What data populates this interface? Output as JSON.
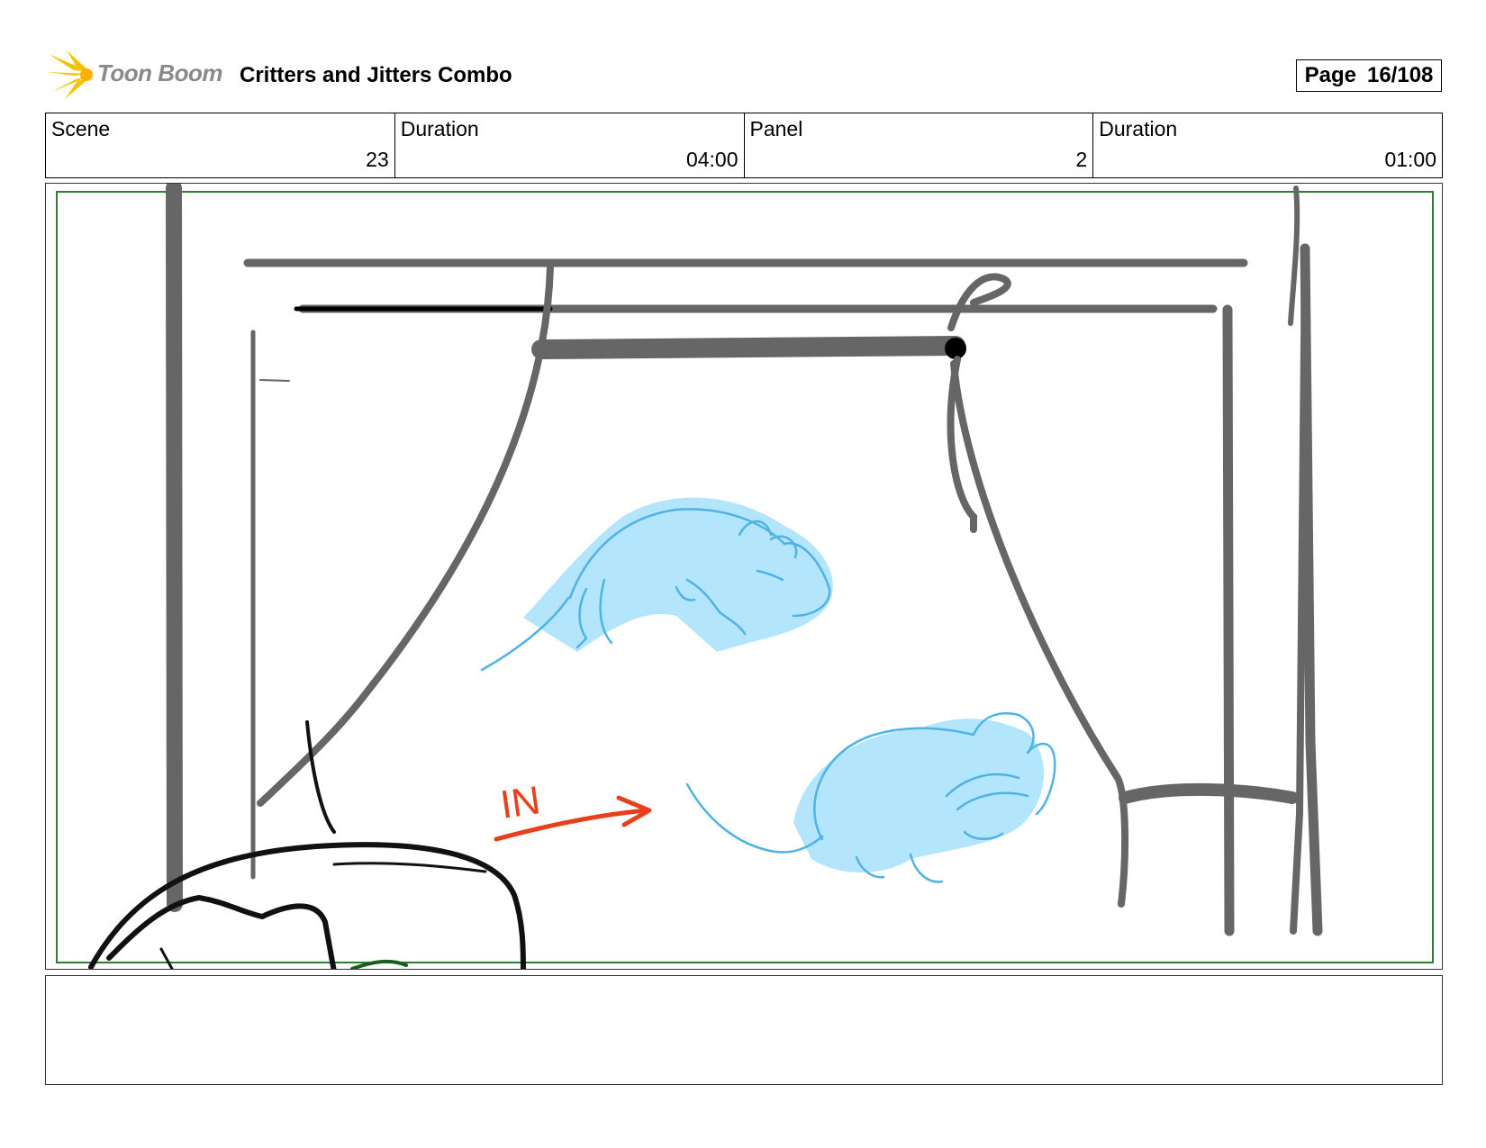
{
  "header": {
    "logo_text": "Toon Boom",
    "project_title": "Critters and Jitters Combo",
    "page_label": "Page",
    "page_value": "16/108"
  },
  "info": {
    "scene_label": "Scene",
    "scene_value": "23",
    "scene_duration_label": "Duration",
    "scene_duration_value": "04:00",
    "panel_label": "Panel",
    "panel_value": "2",
    "panel_duration_label": "Duration",
    "panel_duration_value": "01:00"
  },
  "panel": {
    "annotation_text": "IN",
    "colors": {
      "safe_frame": "#2e7d32",
      "set_lines": "#666666",
      "mouse_fill": "#b3e5fc",
      "mouse_line": "#4fb3e6",
      "annotation": "#e8401c"
    }
  },
  "notes": {
    "text": ""
  }
}
